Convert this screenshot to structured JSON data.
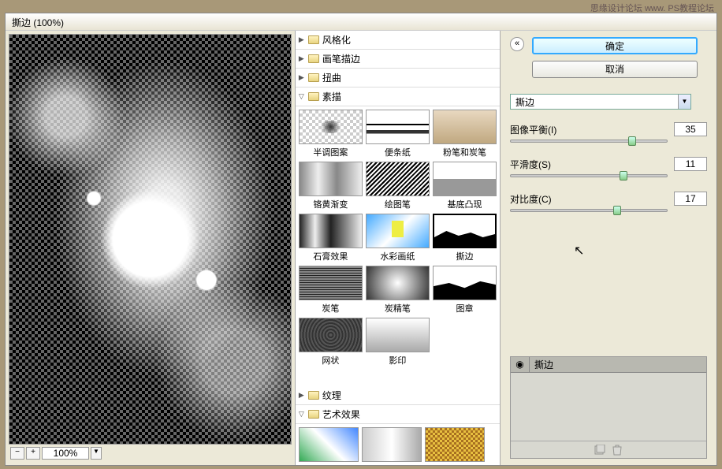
{
  "watermark": "思缘设计论坛  www.    PS教程论坛",
  "title": "撕边 (100%)",
  "zoom": {
    "value": "100%"
  },
  "categories": {
    "stylize": "风格化",
    "brush": "画笔描边",
    "distort": "扭曲",
    "sketch": "素描",
    "texture": "纹理",
    "artistic": "艺术效果"
  },
  "thumbs": [
    "半调图案",
    "便条纸",
    "粉笔和炭笔",
    "铬黄渐变",
    "绘图笔",
    "基底凸现",
    "石膏效果",
    "水彩画纸",
    "撕边",
    "炭笔",
    "炭精笔",
    "图章",
    "网状",
    "影印"
  ],
  "buttons": {
    "ok": "确定",
    "cancel": "取消"
  },
  "filter_select": "撕边",
  "sliders": [
    {
      "label": "图像平衡(I)",
      "value": "35",
      "pos": 78
    },
    {
      "label": "平滑度(S)",
      "value": "11",
      "pos": 72
    },
    {
      "label": "对比度(C)",
      "value": "17",
      "pos": 68
    }
  ],
  "layer": {
    "name": "撕边"
  }
}
